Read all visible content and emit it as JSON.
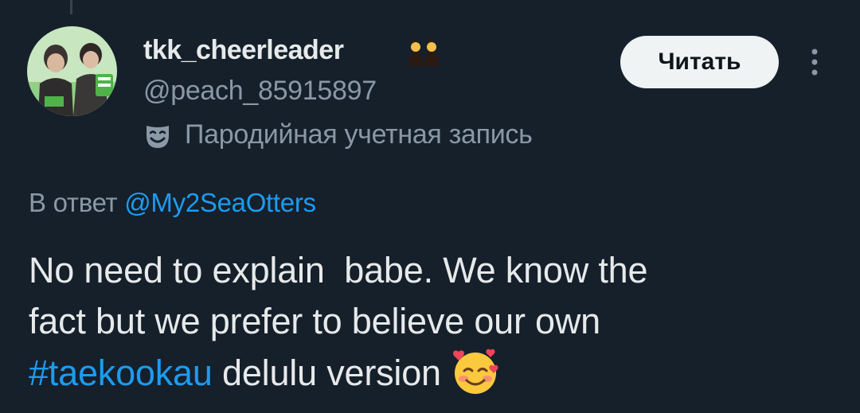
{
  "author": {
    "display_name": "tkk_cheerleader",
    "name_emoji": "people-with-bunny-ears-emoji",
    "handle": "@peach_85915897",
    "parody_icon": "theater-mask-icon",
    "parody_label": "Пародийная учетная запись",
    "avatar": "profile-photo"
  },
  "actions": {
    "follow_label": "Читать",
    "more_icon": "more-vertical-icon"
  },
  "reply": {
    "prefix": "В ответ",
    "mention": "@My2SeaOtters"
  },
  "tweet": {
    "text_part1": "No need to explain  babe. We know the\nfact but we prefer to believe our own\n",
    "hashtag": "#taekookau",
    "text_part2": " delulu version ",
    "emoji": "smiling-face-with-hearts-emoji"
  },
  "colors": {
    "background": "#15202b",
    "primary_text": "#e7e9ea",
    "secondary_text": "#8b98a5",
    "link": "#1d9bf0",
    "button_bg": "#eff3f4",
    "button_text": "#0f1419"
  }
}
